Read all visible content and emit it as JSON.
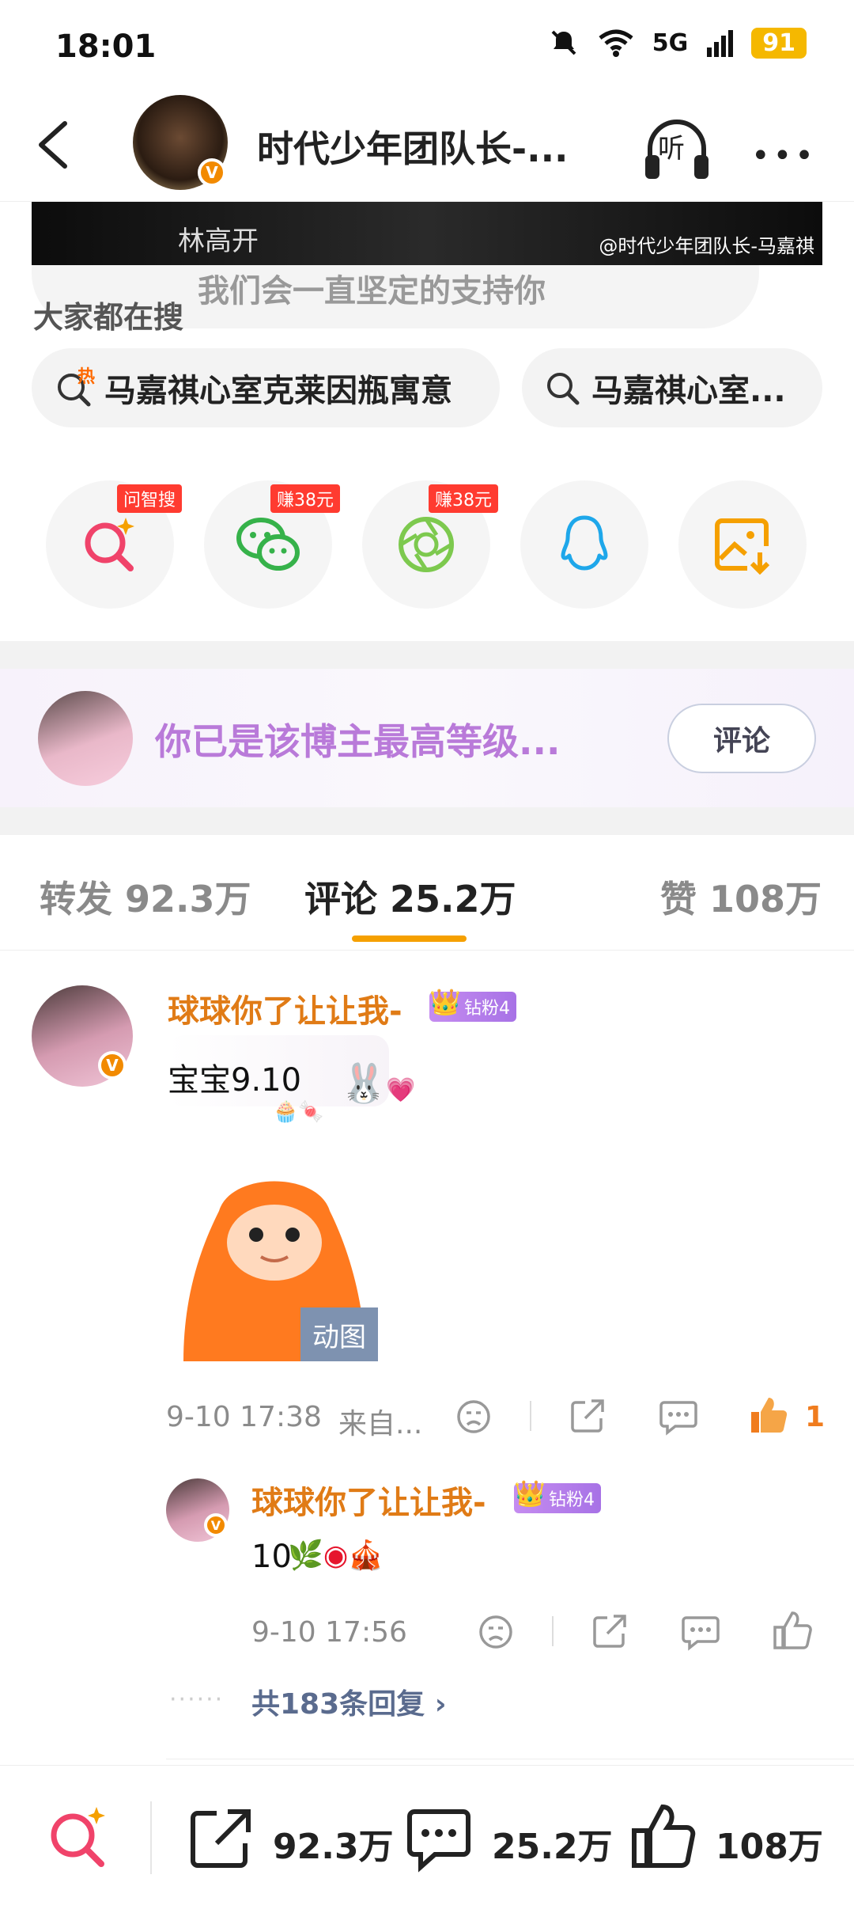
{
  "status_bar": {
    "time": "18:01",
    "network": "5G",
    "battery": "91"
  },
  "header": {
    "title": "时代少年团队长-...",
    "listen_label": "听"
  },
  "banner": {
    "watermark": "@时代少年团队长-马嘉祺",
    "faded_name": "林高开",
    "faded_text": "我们会一直坚定的支持你"
  },
  "hot_search": {
    "label": "大家都在搜",
    "chips": [
      {
        "text": "马嘉祺心室克莱因瓶寓意",
        "tag": "热"
      },
      {
        "text": "马嘉祺心室..."
      }
    ]
  },
  "share": {
    "buttons": [
      {
        "icon": "ai-search-icon",
        "tag": "问智搜"
      },
      {
        "icon": "wechat-icon",
        "tag": "赚38元"
      },
      {
        "icon": "moments-icon",
        "tag": "赚38元"
      },
      {
        "icon": "qq-icon",
        "tag": ""
      },
      {
        "icon": "save-image-icon",
        "tag": ""
      }
    ]
  },
  "fan_card": {
    "text": "你已是该博主最高等级...",
    "button": "评论"
  },
  "tabs": [
    {
      "label": "转发 92.3万"
    },
    {
      "label": "评论 25.2万"
    },
    {
      "label": "赞 108万"
    }
  ],
  "comments": [
    {
      "user": "球球你了让让我-",
      "fan_badge": "钻粉4",
      "text": "宝宝9.10",
      "gif_label": "动图",
      "time": "9-10 17:38",
      "source": "来自...",
      "likes": "1"
    }
  ],
  "reply": {
    "user": "球球你了让让我-",
    "fan_badge": "钻粉4",
    "text": "10",
    "time": "9-10 17:56",
    "more_replies": "共183条回复"
  },
  "bottom_bar": {
    "reposts": "92.3万",
    "comments": "25.2万",
    "likes": "108万"
  },
  "colors": {
    "accent_orange": "#f5a000",
    "username": "#e07b16",
    "fan_purple": "#b97ad9",
    "like_orange": "#f07c1e"
  }
}
